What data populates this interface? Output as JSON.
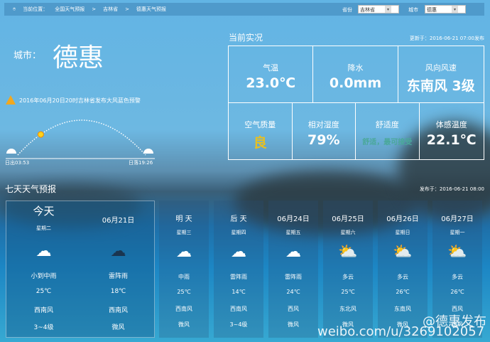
{
  "breadcrumb": {
    "label": "当前位置：",
    "items": [
      "全国天气预报",
      "吉林省",
      "德惠天气预报"
    ],
    "sep": ">"
  },
  "selectors": {
    "province_label": "省份",
    "province": "吉林省",
    "city_label": "城市",
    "city": "德惠"
  },
  "city": {
    "label": "城市：",
    "name": "德惠"
  },
  "alert": "2016年06月20日20时吉林省发布大风蓝色预警",
  "sun": {
    "sunrise": "日出03:53",
    "sunset": "日落19:26",
    "progress": 0.18
  },
  "current": {
    "title": "当前实况",
    "updated": "更新于：2016-06-21 07:00发布",
    "row1": [
      {
        "label": "气温",
        "value": "23.0℃"
      },
      {
        "label": "降水",
        "value": "0.0mm"
      },
      {
        "label": "风向风速",
        "value": "东南风 3级"
      }
    ],
    "row2": [
      {
        "label": "空气质量",
        "value": "良",
        "color": "#e8c020"
      },
      {
        "label": "相对湿度",
        "value": "79%"
      },
      {
        "label": "舒适度",
        "value": "舒适，最可接受",
        "color": "#4aa89a"
      },
      {
        "label": "体感温度",
        "value": "22.1℃"
      }
    ]
  },
  "forecast": {
    "title": "七天天气预报",
    "published": "发布于：2016-06-21 08:00",
    "today": {
      "day": "今天",
      "date": "06月21日",
      "weekday": "星期二",
      "day_part": {
        "icon": "rain-cloud-icon",
        "weather": "小到中雨",
        "temp": "25℃",
        "wind": "西南风",
        "force": "3~4级"
      },
      "night_part": {
        "icon": "thunder-rain-icon",
        "weather": "雷阵雨",
        "temp": "18℃",
        "wind": "西南风",
        "force": "微风"
      }
    },
    "days": [
      {
        "day": "明 天",
        "weekday": "星期三",
        "icon": "rain-cloud-icon",
        "weather": "中雨",
        "temp": "25℃",
        "wind": "西南风",
        "force": "微风"
      },
      {
        "day": "后 天",
        "weekday": "星期四",
        "icon": "thunder-rain-icon",
        "weather": "雷阵雨",
        "temp": "14℃",
        "wind": "西南风",
        "force": "3~4级"
      },
      {
        "day": "06月24日",
        "weekday": "星期五",
        "icon": "thunder-rain-icon",
        "weather": "雷阵雨",
        "temp": "24℃",
        "wind": "西风",
        "force": "微风"
      },
      {
        "day": "06月25日",
        "weekday": "星期六",
        "icon": "partly-cloudy-icon",
        "weather": "多云",
        "temp": "25℃",
        "wind": "东北风",
        "force": "微风"
      },
      {
        "day": "06月26日",
        "weekday": "星期日",
        "icon": "partly-cloudy-icon",
        "weather": "多云",
        "temp": "26℃",
        "wind": "东南风",
        "force": "微风"
      },
      {
        "day": "06月27日",
        "weekday": "星期一",
        "icon": "partly-cloudy-icon",
        "weather": "多云",
        "temp": "26℃",
        "wind": "西风",
        "force": "微风"
      }
    ]
  },
  "watermark": {
    "handle": "@德惠发布",
    "url": "weibo.com/u/3269102057"
  }
}
